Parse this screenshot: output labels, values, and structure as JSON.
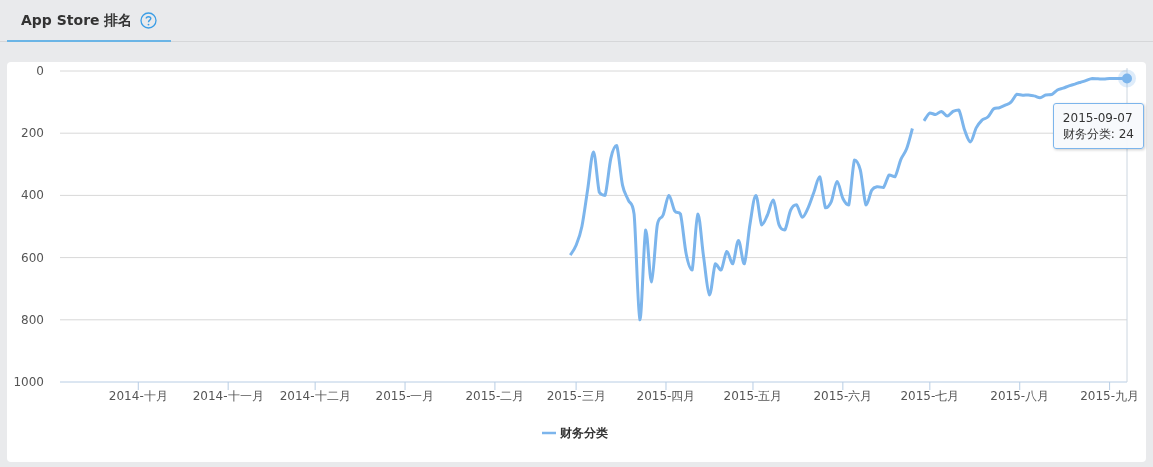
{
  "tabs": [
    {
      "label": "App Store 排名",
      "selected": true
    }
  ],
  "chart": {
    "chart_data": {
      "type": "line",
      "x": [
        "2015-02-27",
        "2015-03-01",
        "2015-03-03",
        "2015-03-05",
        "2015-03-07",
        "2015-03-09",
        "2015-03-11",
        "2015-03-13",
        "2015-03-15",
        "2015-03-17",
        "2015-03-19",
        "2015-03-21",
        "2015-03-23",
        "2015-03-25",
        "2015-03-27",
        "2015-03-29",
        "2015-03-31",
        "2015-04-02",
        "2015-04-04",
        "2015-04-06",
        "2015-04-08",
        "2015-04-10",
        "2015-04-12",
        "2015-04-14",
        "2015-04-16",
        "2015-04-18",
        "2015-04-20",
        "2015-04-22",
        "2015-04-24",
        "2015-04-26",
        "2015-04-28",
        "2015-04-30",
        "2015-05-02",
        "2015-05-04",
        "2015-05-06",
        "2015-05-08",
        "2015-05-10",
        "2015-05-12",
        "2015-05-14",
        "2015-05-16",
        "2015-05-18",
        "2015-05-20",
        "2015-05-22",
        "2015-05-24",
        "2015-05-26",
        "2015-05-28",
        "2015-05-30",
        "2015-06-01",
        "2015-06-03",
        "2015-06-05",
        "2015-06-07",
        "2015-06-09",
        "2015-06-11",
        "2015-06-13",
        "2015-06-15",
        "2015-06-17",
        "2015-06-19",
        "2015-06-21",
        "2015-06-23",
        "2015-06-25",
        "2015-06-27",
        "2015-06-29",
        "2015-07-01",
        "2015-07-03",
        "2015-07-05",
        "2015-07-07",
        "2015-07-09",
        "2015-07-11",
        "2015-07-13",
        "2015-07-15",
        "2015-07-17",
        "2015-07-19",
        "2015-07-21",
        "2015-07-23",
        "2015-07-25",
        "2015-07-27",
        "2015-07-29",
        "2015-07-31",
        "2015-08-02",
        "2015-08-04",
        "2015-08-06",
        "2015-08-08",
        "2015-08-10",
        "2015-08-12",
        "2015-08-14",
        "2015-08-16",
        "2015-08-18",
        "2015-08-20",
        "2015-08-22",
        "2015-08-24",
        "2015-08-26",
        "2015-08-28",
        "2015-08-30",
        "2015-09-01",
        "2015-09-03",
        "2015-09-05",
        "2015-09-07"
      ],
      "series": [
        {
          "name": "财务分类",
          "color": "#7cb5ec",
          "values": [
            592,
            560,
            500,
            380,
            260,
            390,
            400,
            280,
            240,
            367,
            415,
            460,
            800,
            511,
            678,
            495,
            463,
            400,
            450,
            460,
            590,
            640,
            460,
            600,
            720,
            620,
            640,
            580,
            620,
            545,
            620,
            490,
            400,
            495,
            463,
            415,
            495,
            511,
            447,
            430,
            470,
            440,
            390,
            340,
            440,
            420,
            355,
            410,
            431,
            286,
            318,
            431,
            383,
            372,
            375,
            334,
            340,
            285,
            250,
            185,
            null,
            160,
            135,
            140,
            130,
            145,
            130,
            125,
            190,
            228,
            183,
            158,
            148,
            122,
            118,
            110,
            100,
            75,
            78,
            77,
            80,
            86,
            77,
            76,
            61,
            55,
            48,
            42,
            36,
            30,
            24,
            25,
            26,
            24,
            24,
            24,
            24
          ]
        }
      ],
      "xlim": [
        "2014-09-04",
        "2015-09-07"
      ],
      "ylim": [
        1000,
        0
      ],
      "grid": true,
      "yticks": [
        0,
        200,
        400,
        600,
        800,
        1000
      ],
      "xticks": [
        {
          "value": "2014-10-01",
          "label": "2014-十月"
        },
        {
          "value": "2014-11-01",
          "label": "2014-十一月"
        },
        {
          "value": "2014-12-01",
          "label": "2014-十二月"
        },
        {
          "value": "2015-01-01",
          "label": "2015-一月"
        },
        {
          "value": "2015-02-01",
          "label": "2015-二月"
        },
        {
          "value": "2015-03-01",
          "label": "2015-三月"
        },
        {
          "value": "2015-04-01",
          "label": "2015-四月"
        },
        {
          "value": "2015-05-01",
          "label": "2015-五月"
        },
        {
          "value": "2015-06-01",
          "label": "2015-六月"
        },
        {
          "value": "2015-07-01",
          "label": "2015-七月"
        },
        {
          "value": "2015-08-01",
          "label": "2015-八月"
        },
        {
          "value": "2015-09-01",
          "label": "2015-九月"
        }
      ]
    },
    "tooltip": {
      "date": "2015-09-07",
      "text": "财务分类: 24"
    }
  }
}
